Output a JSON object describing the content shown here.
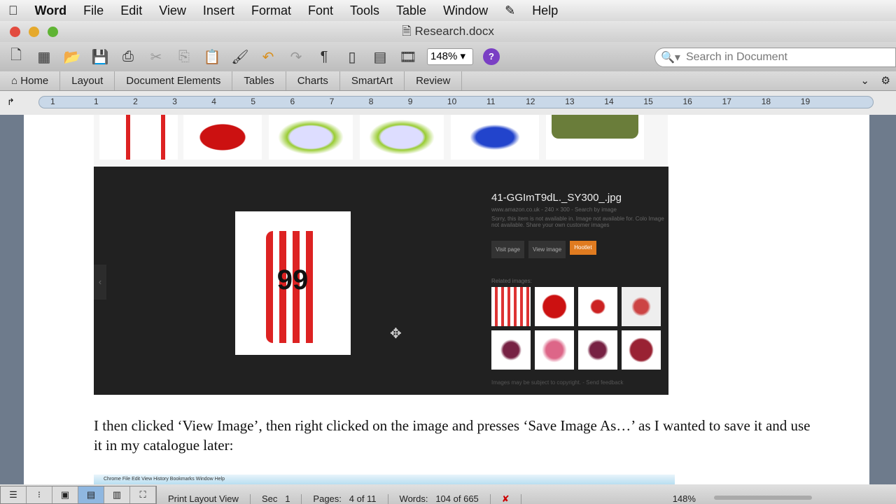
{
  "menubar": {
    "items": [
      "Word",
      "File",
      "Edit",
      "View",
      "Insert",
      "Format",
      "Font",
      "Tools",
      "Table",
      "Window",
      "Help"
    ]
  },
  "window": {
    "title": "Research.docx"
  },
  "toolbar": {
    "zoom": "148%",
    "search_placeholder": "Search in Document"
  },
  "ribbon": {
    "tabs": [
      "Home",
      "Layout",
      "Document Elements",
      "Tables",
      "Charts",
      "SmartArt",
      "Review"
    ]
  },
  "ruler": {
    "labels": [
      "1",
      "1",
      "2",
      "3",
      "4",
      "5",
      "6",
      "7",
      "8",
      "9",
      "10",
      "11",
      "12",
      "13",
      "14",
      "15",
      "16",
      "17",
      "18",
      "19"
    ]
  },
  "image_panel": {
    "filename": "41-GGImT9dL._SY300_.jpg",
    "source": "www.amazon.co.uk - 240 × 300 - Search by image",
    "note": "Sorry, this item is not available in. Image not available for. Colo Image not available. Share your own customer images",
    "buttons": [
      "Visit page",
      "View image",
      "Hootlet"
    ],
    "related_label": "Related images:",
    "footer": "Images may be subject to copyright. - Send feedback",
    "phone_number": "99"
  },
  "document": {
    "paragraph": "I then clicked ‘View Image’, then right clicked on the image and presses ‘Save Image As…’ as I wanted to save it and use it in my catalogue later:",
    "chrome_menu": "Chrome  File  Edit  View  History  Bookmarks  Window  Help"
  },
  "status": {
    "view": "Print Layout View",
    "sec_label": "Sec",
    "sec": "1",
    "pages_label": "Pages:",
    "pages": "4 of 11",
    "words_label": "Words:",
    "words": "104 of 665",
    "zoom": "148%"
  }
}
